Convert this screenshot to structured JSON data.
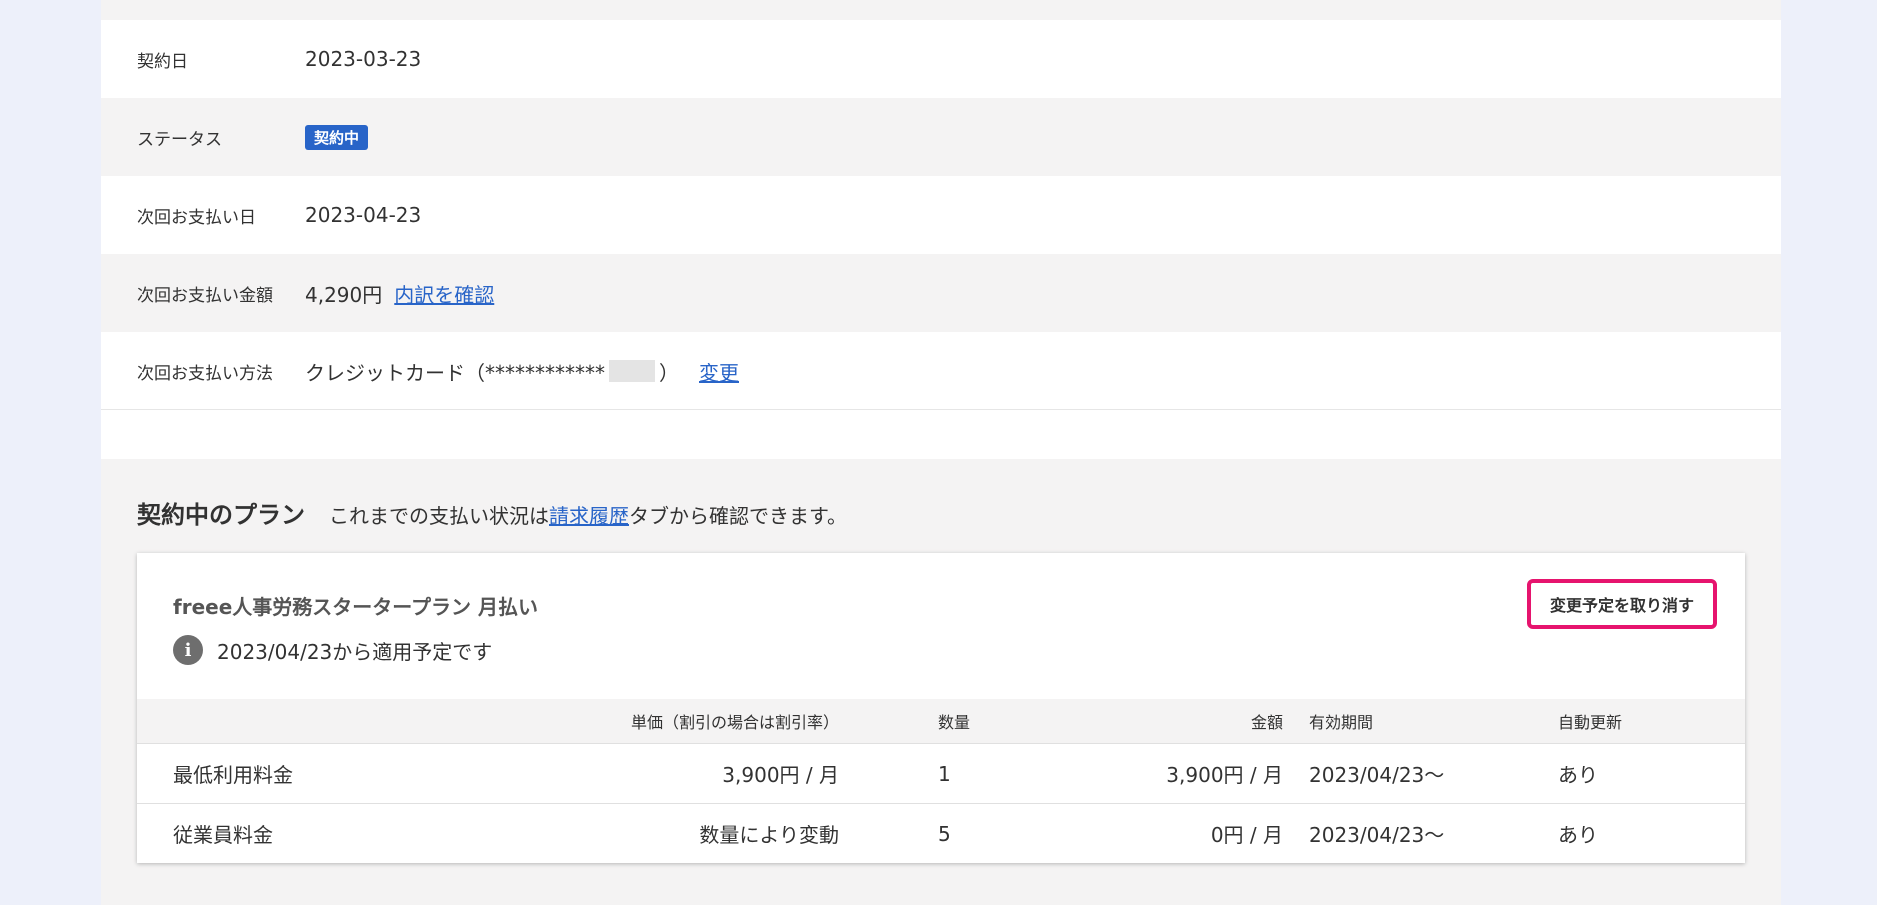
{
  "contract": {
    "rows": [
      {
        "label": "契約日",
        "value": "2023-03-23"
      },
      {
        "label": "ステータス",
        "badge": "契約中"
      },
      {
        "label": "次回お支払い日",
        "value": "2023-04-23"
      },
      {
        "label": "次回お支払い金額",
        "value": "4,290円",
        "link": "内訳を確認"
      },
      {
        "label": "次回お支払い方法",
        "value_prefix": "クレジットカード（************",
        "value_suffix": "）",
        "link": "変更"
      }
    ]
  },
  "plan_section": {
    "title": "契約中のプラン",
    "desc_before": "これまでの支払い状況は",
    "desc_link": "請求履歴",
    "desc_after": "タブから確認できます。"
  },
  "card": {
    "plan_name": "freee人事労務スタータープラン 月払い",
    "note": "2023/04/23から適用予定です",
    "cancel_button": "変更予定を取り消す",
    "columns": {
      "name": "",
      "unit_price": "単価（割引の場合は割引率）",
      "quantity": "数量",
      "amount": "金額",
      "period": "有効期間",
      "auto_renew": "自動更新"
    },
    "rows": [
      {
        "name": "最低利用料金",
        "unit_price": "3,900円 / 月",
        "quantity": "1",
        "amount": "3,900円 / 月",
        "period": "2023/04/23〜",
        "auto_renew": "あり"
      },
      {
        "name": "従業員料金",
        "unit_price": "数量により変動",
        "quantity": "5",
        "amount": "0円 / 月",
        "period": "2023/04/23〜",
        "auto_renew": "あり"
      }
    ]
  },
  "colors": {
    "background": "#edf0fa",
    "panel": "#f4f3f3",
    "badge": "#2864c8",
    "link": "#2864c8",
    "highlight": "#e6146e"
  },
  "icons": {
    "info": "info-circle-icon"
  }
}
